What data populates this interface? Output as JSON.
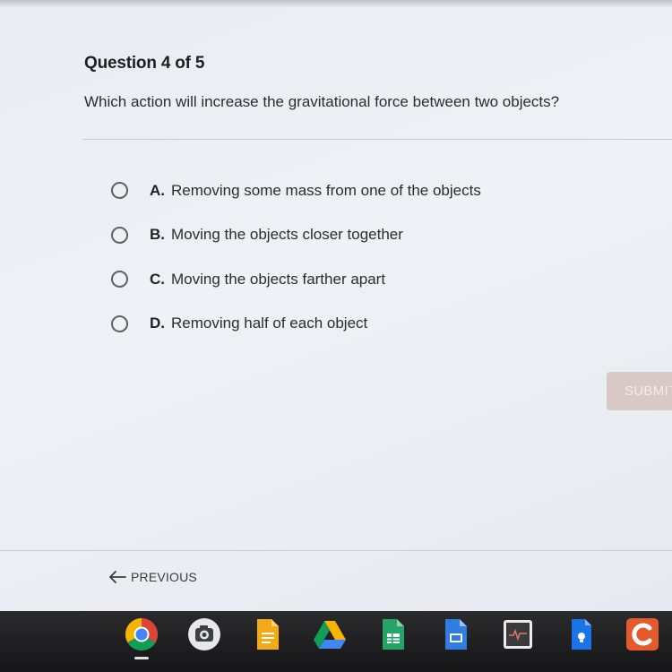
{
  "question": {
    "number_label": "Question 4 of 5",
    "prompt": "Which action will increase the gravitational force between two objects?"
  },
  "answers": [
    {
      "letter": "A.",
      "text": "Removing some mass from one of the objects"
    },
    {
      "letter": "B.",
      "text": "Moving the objects closer together"
    },
    {
      "letter": "C.",
      "text": "Moving the objects farther apart"
    },
    {
      "letter": "D.",
      "text": "Removing half of each object"
    }
  ],
  "submit_label": "SUBMIT",
  "previous_label": "PREVIOUS",
  "shelf": {
    "apps": [
      "chrome-icon",
      "camera-icon",
      "docs-icon",
      "drive-icon",
      "sheets-icon",
      "slides-icon",
      "screen-recorder-icon",
      "keep-icon",
      "canvas-icon"
    ],
    "accent_colors": {
      "submit": "#d8c8c6",
      "docs": "#f4a916",
      "sheets": "#22a565",
      "slides_blue": "#2f7de1",
      "canvas": "#e55a2c"
    }
  }
}
